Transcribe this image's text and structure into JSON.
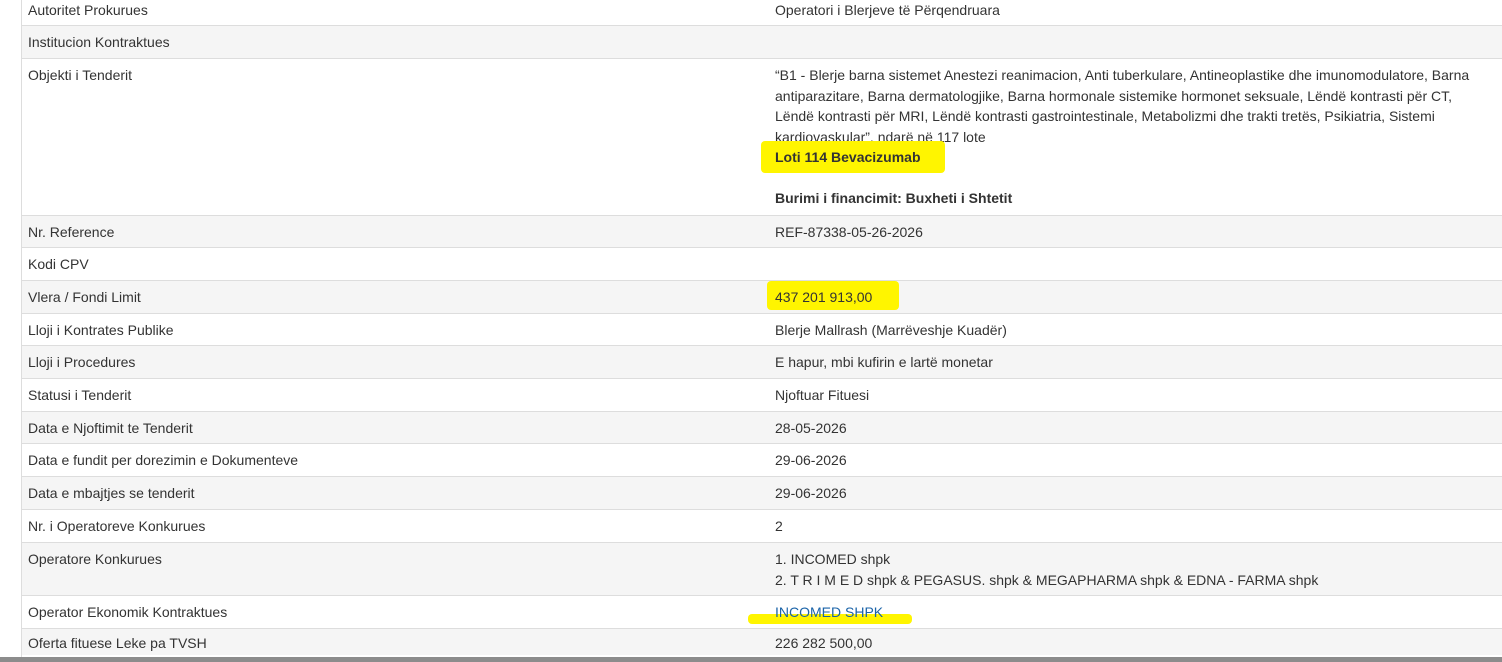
{
  "highlight_color": "#fff500",
  "link_color": "#1a63a8",
  "rows": {
    "autoritet": {
      "label": "Autoritet Prokurues",
      "value": "Operatori i Blerjeve të Përqendruara"
    },
    "institucion": {
      "label": "Institucion Kontraktues",
      "value": ""
    },
    "objekti": {
      "label": "Objekti i Tenderit",
      "value_line1": "“B1 - Blerje barna sistemet Anestezi reanimacion, Anti tuberkulare, Antineoplastike dhe imunomodulatore, Barna",
      "value_line2": "antiparazitare, Barna dermatologjike, Barna hormonale sistemike hormonet seksuale, Lëndë kontrasti për CT,",
      "value_line3": "Lëndë kontrasti për MRI, Lëndë kontrasti gastrointestinale, Metabolizmi dhe trakti tretës, Psikiatria, Sistemi",
      "value_line4": "kardiovaskular”, ndarë në 117 lote",
      "lot": "Loti 114 Bevacizumab",
      "funding": "Burimi i financimit: Buxheti i Shtetit"
    },
    "reference": {
      "label": "Nr. Reference",
      "value": "REF-87338-05-26-2026"
    },
    "cpv": {
      "label": "Kodi CPV",
      "value": ""
    },
    "vlera": {
      "label": "Vlera / Fondi Limit",
      "value": "437 201 913,00"
    },
    "lloji_kontrates": {
      "label": "Lloji i Kontrates Publike",
      "value": "Blerje Mallrash (Marrëveshje Kuadër)"
    },
    "lloji_procedures": {
      "label": "Lloji i Procedures",
      "value": "E hapur, mbi kufirin e lartë monetar"
    },
    "statusi": {
      "label": "Statusi i Tenderit",
      "value": "Njoftuar Fituesi"
    },
    "data_njoftimit": {
      "label": "Data e Njoftimit te Tenderit",
      "value": "28-05-2026"
    },
    "data_fundit": {
      "label": "Data e fundit per dorezimin e Dokumenteve",
      "value": "29-06-2026"
    },
    "data_mbajtjes": {
      "label": "Data e mbajtjes se tenderit",
      "value": "29-06-2026"
    },
    "nr_operatoreve": {
      "label": "Nr. i Operatoreve Konkurues",
      "value": "2"
    },
    "operatore": {
      "label": "Operatore Konkurues",
      "value_line1": "1. INCOMED shpk",
      "value_line2": "2. T R I M E D shpk & PEGASUS. shpk & MEGAPHARMA shpk & EDNA - FARMA shpk"
    },
    "operator_ekonomik": {
      "label": "Operator Ekonomik Kontraktues",
      "value": "INCOMED SHPK"
    },
    "oferta": {
      "label": "Oferta fituese Leke pa TVSH",
      "value": "226 282 500,00"
    }
  }
}
